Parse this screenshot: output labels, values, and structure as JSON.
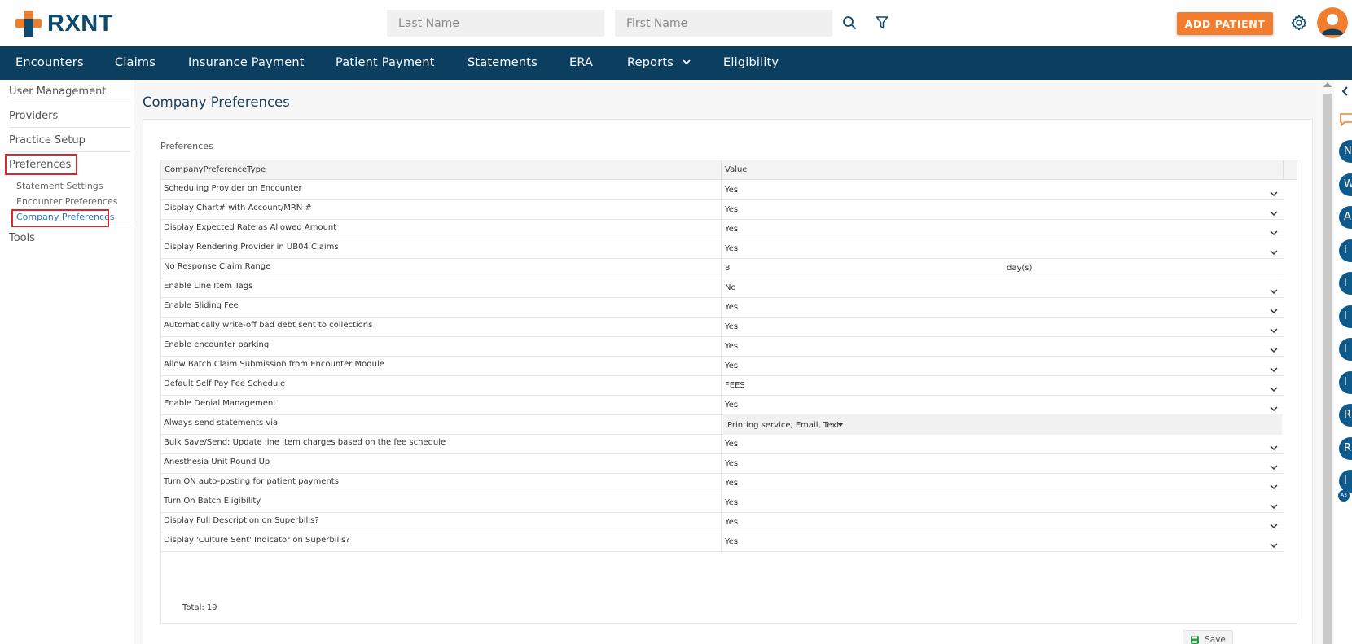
{
  "brand": {
    "name": "RXNT"
  },
  "search": {
    "last_name_placeholder": "Last Name",
    "first_name_placeholder": "First Name"
  },
  "header": {
    "add_patient_label": "ADD PATIENT"
  },
  "nav": {
    "items": [
      {
        "label": "Encounters"
      },
      {
        "label": "Claims"
      },
      {
        "label": "Insurance Payment"
      },
      {
        "label": "Patient Payment"
      },
      {
        "label": "Statements"
      },
      {
        "label": "ERA"
      },
      {
        "label": "Reports"
      },
      {
        "label": "Eligibility"
      }
    ]
  },
  "sidebar": {
    "items": [
      {
        "label": "User Management"
      },
      {
        "label": "Providers"
      },
      {
        "label": "Practice Setup"
      },
      {
        "label": "Preferences"
      },
      {
        "label": "Tools"
      }
    ],
    "subitems": [
      {
        "label": "Statement Settings"
      },
      {
        "label": "Encounter Preferences"
      },
      {
        "label": "Company Preferences"
      }
    ]
  },
  "main": {
    "title": "Company Preferences",
    "section_title": "Preferences",
    "columns": {
      "type": "CompanyPreferenceType",
      "value": "Value"
    },
    "rows": [
      {
        "type": "Scheduling Provider on Encounter",
        "value": "Yes"
      },
      {
        "type": "Display Chart# with Account/MRN #",
        "value": "Yes"
      },
      {
        "type": "Display Expected Rate as Allowed Amount",
        "value": "Yes"
      },
      {
        "type": "Display Rendering Provider in UB04 Claims",
        "value": "Yes"
      },
      {
        "type": "No Response Claim Range",
        "value": "8",
        "suffix": "day(s)"
      },
      {
        "type": "Enable Line Item Tags",
        "value": "No"
      },
      {
        "type": "Enable Sliding Fee",
        "value": "Yes"
      },
      {
        "type": "Automatically write-off bad debt sent to collections",
        "value": "Yes"
      },
      {
        "type": "Enable encounter parking",
        "value": "Yes"
      },
      {
        "type": "Allow Batch Claim Submission from Encounter Module",
        "value": "Yes"
      },
      {
        "type": "Default Self Pay Fee Schedule",
        "value": "FEES"
      },
      {
        "type": "Enable Denial Management",
        "value": "Yes"
      },
      {
        "type": "Always send statements via",
        "value": "Printing service,  Email,  Text"
      },
      {
        "type": "Bulk Save/Send: Update line item charges based on the fee schedule",
        "value": "Yes"
      },
      {
        "type": "Anesthesia Unit Round Up",
        "value": "Yes"
      },
      {
        "type": "Turn ON auto-posting for patient payments",
        "value": "Yes"
      },
      {
        "type": "Turn On Batch Eligibility",
        "value": "Yes"
      },
      {
        "type": "Display Full Description on Superbills?",
        "value": "Yes"
      },
      {
        "type": "Display 'Culture Sent' Indicator on Superbills?",
        "value": "Yes"
      }
    ],
    "total_label": "Total: 19",
    "save_label": "Save"
  },
  "rail": {
    "initials": [
      "N",
      "W",
      "A",
      "I",
      "I",
      "I",
      "I",
      "I",
      "R",
      "R",
      "I"
    ],
    "small_badge": "A3"
  },
  "colors": {
    "brand_navy": "#0c3e60",
    "accent_orange": "#f27d2e",
    "highlight_red": "#e2242b",
    "rail_blue": "#0f5a8d"
  }
}
